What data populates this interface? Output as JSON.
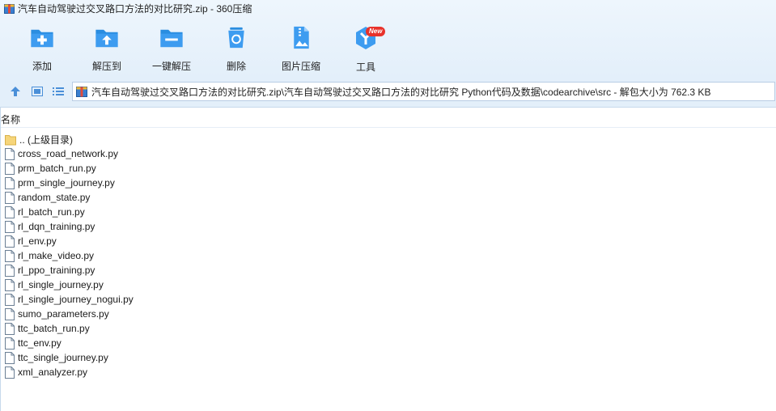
{
  "window": {
    "title": "汽车自动驾驶过交叉路口方法的对比研究.zip - 360压缩"
  },
  "toolbar": {
    "items": [
      {
        "label": "添加",
        "icon": "add-icon"
      },
      {
        "label": "解压到",
        "icon": "extract-to-icon"
      },
      {
        "label": "一键解压",
        "icon": "one-click-extract-icon"
      },
      {
        "label": "删除",
        "icon": "delete-icon"
      },
      {
        "label": "图片压缩",
        "icon": "image-compress-icon"
      },
      {
        "label": "工具",
        "icon": "tools-icon",
        "badge": "New"
      }
    ]
  },
  "address": {
    "path": "汽车自动驾驶过交叉路口方法的对比研究.zip\\汽车自动驾驶过交叉路口方法的对比研究 Python代码及数据\\codearchive\\src - 解包大小为 762.3 KB"
  },
  "list": {
    "column_name": "名称",
    "parent": ".. (上级目录)",
    "files": [
      "cross_road_network.py",
      "prm_batch_run.py",
      "prm_single_journey.py",
      "random_state.py",
      "rl_batch_run.py",
      "rl_dqn_training.py",
      "rl_env.py",
      "rl_make_video.py",
      "rl_ppo_training.py",
      "rl_single_journey.py",
      "rl_single_journey_nogui.py",
      "sumo_parameters.py",
      "ttc_batch_run.py",
      "ttc_env.py",
      "ttc_single_journey.py",
      "xml_analyzer.py"
    ]
  },
  "colors": {
    "toolbar_bg": "#e3effa",
    "icon_blue": "#2a8de0",
    "badge_red": "#e8322b",
    "folder_yellow": "#f6d57a"
  }
}
